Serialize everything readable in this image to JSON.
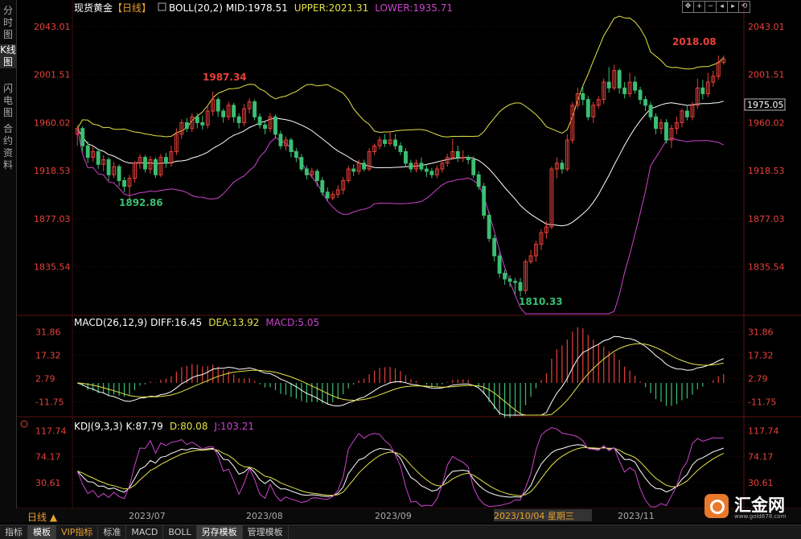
{
  "left_tabs": [
    {
      "label": "分时图",
      "active": false
    },
    {
      "label": "K线图",
      "active": true
    },
    {
      "label": "闪电图",
      "active": false
    },
    {
      "label": "合约资料",
      "active": false
    }
  ],
  "main_header": {
    "title": "现货黄金",
    "period": "【日线】",
    "indicator": "BOLL(20,2)",
    "mid": "MID:1978.51",
    "upper": "UPPER:2021.31",
    "lower": "LOWER:1935.71"
  },
  "macd_header": {
    "title": "MACD(26,12,9)",
    "diff": "DIFF:16.45",
    "dea": "DEA:13.92",
    "macd": "MACD:5.05"
  },
  "kdj_header": {
    "title": "KDJ(9,3,3)",
    "k": "K:87.79",
    "d": "D:80.08",
    "j": "J:103.21"
  },
  "price_axis": {
    "ticks": [
      "2043.01",
      "2001.51",
      "1960.02",
      "1918.53",
      "1877.03",
      "1835.54"
    ],
    "current": "1975.05"
  },
  "macd_axis": {
    "ticks": [
      "31.86",
      "17.32",
      "2.79",
      "-11.75"
    ]
  },
  "kdj_axis": {
    "ticks": [
      "117.74",
      "74.17",
      "30.61"
    ]
  },
  "annotations": {
    "high1": "1987.34",
    "low1": "1892.86",
    "low2": "1810.33",
    "high2": "2018.08"
  },
  "x_axis": {
    "period_label": "日线",
    "labels": [
      "2023/07",
      "2023/08",
      "2023/09",
      "2023/10/04 星期三",
      "2023/11"
    ]
  },
  "toolbar_icons": [
    "cross-arrows",
    "zoom-in",
    "zoom-out",
    "prev",
    "next",
    "restore"
  ],
  "bottom_tabs": [
    {
      "label": "指标",
      "active": false
    },
    {
      "label": "模板",
      "active": true
    },
    {
      "label": "VIP指标",
      "active": false,
      "vip": true
    },
    {
      "label": "标准",
      "active": false
    },
    {
      "label": "MACD",
      "active": false
    },
    {
      "label": "BOLL",
      "active": false
    },
    {
      "label": "另存模板",
      "active": true
    },
    {
      "label": "管理模板",
      "active": false
    }
  ],
  "logo": {
    "text": "汇金网",
    "url": "www.gold678.com"
  },
  "colors": {
    "up": "#e8413a",
    "down": "#3bbf73",
    "mid": "#ffffff",
    "upper": "#e3e34a",
    "lower": "#cc44cc",
    "axis": "#e8413a",
    "grid": "#3a1010"
  },
  "chart_data": {
    "type": "candlestick",
    "title": "现货黄金【日线】",
    "ylim": [
      1795,
      2052
    ],
    "candles": [
      [
        1950,
        1955,
        1958,
        1940
      ],
      [
        1955,
        1940,
        1957,
        1935
      ],
      [
        1940,
        1930,
        1944,
        1925
      ],
      [
        1930,
        1935,
        1940,
        1926
      ],
      [
        1935,
        1924,
        1937,
        1920
      ],
      [
        1924,
        1928,
        1932,
        1918
      ],
      [
        1928,
        1915,
        1930,
        1910
      ],
      [
        1915,
        1922,
        1926,
        1912
      ],
      [
        1922,
        1910,
        1924,
        1905
      ],
      [
        1910,
        1905,
        1913,
        1900
      ],
      [
        1905,
        1912,
        1915,
        1893
      ],
      [
        1912,
        1925,
        1927,
        1908
      ],
      [
        1925,
        1930,
        1933,
        1920
      ],
      [
        1930,
        1920,
        1932,
        1917
      ],
      [
        1920,
        1928,
        1931,
        1916
      ],
      [
        1928,
        1915,
        1930,
        1912
      ],
      [
        1915,
        1930,
        1933,
        1913
      ],
      [
        1930,
        1925,
        1934,
        1921
      ],
      [
        1925,
        1935,
        1940,
        1922
      ],
      [
        1935,
        1950,
        1955,
        1932
      ],
      [
        1950,
        1960,
        1963,
        1946
      ],
      [
        1960,
        1955,
        1964,
        1952
      ],
      [
        1955,
        1965,
        1968,
        1952
      ],
      [
        1965,
        1960,
        1968,
        1955
      ],
      [
        1960,
        1958,
        1966,
        1954
      ],
      [
        1958,
        1970,
        1975,
        1955
      ],
      [
        1970,
        1980,
        1987,
        1966
      ],
      [
        1980,
        1970,
        1982,
        1965
      ],
      [
        1970,
        1965,
        1972,
        1960
      ],
      [
        1965,
        1975,
        1978,
        1962
      ],
      [
        1975,
        1965,
        1977,
        1960
      ],
      [
        1965,
        1960,
        1968,
        1955
      ],
      [
        1960,
        1972,
        1976,
        1957
      ],
      [
        1972,
        1978,
        1981,
        1968
      ],
      [
        1978,
        1965,
        1980,
        1962
      ],
      [
        1965,
        1958,
        1968,
        1955
      ],
      [
        1958,
        1955,
        1961,
        1950
      ],
      [
        1955,
        1965,
        1968,
        1952
      ],
      [
        1965,
        1950,
        1967,
        1947
      ],
      [
        1950,
        1940,
        1953,
        1937
      ],
      [
        1940,
        1945,
        1948,
        1936
      ],
      [
        1945,
        1935,
        1947,
        1930
      ],
      [
        1935,
        1930,
        1938,
        1926
      ],
      [
        1930,
        1920,
        1933,
        1918
      ],
      [
        1920,
        1915,
        1923,
        1911
      ],
      [
        1915,
        1918,
        1921,
        1912
      ],
      [
        1918,
        1910,
        1920,
        1905
      ],
      [
        1910,
        1900,
        1913,
        1897
      ],
      [
        1900,
        1895,
        1904,
        1892
      ],
      [
        1895,
        1898,
        1901,
        1893
      ],
      [
        1898,
        1902,
        1906,
        1895
      ],
      [
        1902,
        1910,
        1913,
        1898
      ],
      [
        1910,
        1920,
        1923,
        1908
      ],
      [
        1920,
        1918,
        1924,
        1914
      ],
      [
        1918,
        1925,
        1928,
        1915
      ],
      [
        1925,
        1920,
        1928,
        1918
      ],
      [
        1920,
        1935,
        1938,
        1918
      ],
      [
        1935,
        1940,
        1942,
        1932
      ],
      [
        1940,
        1945,
        1948,
        1937
      ],
      [
        1945,
        1942,
        1950,
        1939
      ],
      [
        1942,
        1945,
        1952,
        1940
      ],
      [
        1945,
        1940,
        1950,
        1937
      ],
      [
        1940,
        1935,
        1943,
        1932
      ],
      [
        1935,
        1925,
        1938,
        1922
      ],
      [
        1925,
        1920,
        1928,
        1917
      ],
      [
        1920,
        1925,
        1928,
        1917
      ],
      [
        1925,
        1920,
        1930,
        1918
      ],
      [
        1920,
        1918,
        1923,
        1913
      ],
      [
        1918,
        1915,
        1921,
        1912
      ],
      [
        1915,
        1920,
        1923,
        1912
      ],
      [
        1920,
        1925,
        1928,
        1917
      ],
      [
        1925,
        1930,
        1933,
        1922
      ],
      [
        1930,
        1935,
        1946,
        1928
      ],
      [
        1935,
        1930,
        1940,
        1926
      ],
      [
        1930,
        1930,
        1936,
        1926
      ],
      [
        1930,
        1928,
        1932,
        1924
      ],
      [
        1928,
        1915,
        1931,
        1912
      ],
      [
        1915,
        1905,
        1918,
        1902
      ],
      [
        1905,
        1880,
        1908,
        1877
      ],
      [
        1880,
        1860,
        1883,
        1857
      ],
      [
        1860,
        1845,
        1863,
        1840
      ],
      [
        1845,
        1830,
        1848,
        1826
      ],
      [
        1830,
        1825,
        1833,
        1820
      ],
      [
        1825,
        1823,
        1828,
        1818
      ],
      [
        1823,
        1822,
        1826,
        1812
      ],
      [
        1822,
        1815,
        1826,
        1810
      ],
      [
        1815,
        1840,
        1842,
        1812
      ],
      [
        1840,
        1845,
        1850,
        1838
      ],
      [
        1845,
        1855,
        1858,
        1840
      ],
      [
        1855,
        1865,
        1868,
        1850
      ],
      [
        1865,
        1870,
        1875,
        1860
      ],
      [
        1870,
        1920,
        1922,
        1868
      ],
      [
        1920,
        1925,
        1930,
        1912
      ],
      [
        1925,
        1920,
        1928,
        1916
      ],
      [
        1920,
        1945,
        1950,
        1918
      ],
      [
        1945,
        1975,
        1978,
        1942
      ],
      [
        1975,
        1985,
        1990,
        1972
      ],
      [
        1985,
        1980,
        1992,
        1975
      ],
      [
        1980,
        1965,
        1983,
        1962
      ],
      [
        1965,
        1975,
        1978,
        1960
      ],
      [
        1975,
        1980,
        1983,
        1972
      ],
      [
        1980,
        1995,
        1998,
        1976
      ],
      [
        1995,
        1990,
        2008,
        1986
      ],
      [
        1990,
        2005,
        2010,
        1988
      ],
      [
        2005,
        1990,
        2007,
        1985
      ],
      [
        1990,
        1985,
        1995,
        1981
      ],
      [
        1985,
        1995,
        2003,
        1982
      ],
      [
        1995,
        1988,
        2000,
        1985
      ],
      [
        1988,
        1980,
        1991,
        1976
      ],
      [
        1980,
        1975,
        1983,
        1970
      ],
      [
        1975,
        1965,
        1978,
        1962
      ],
      [
        1965,
        1955,
        1968,
        1950
      ],
      [
        1955,
        1960,
        1963,
        1950
      ],
      [
        1960,
        1945,
        1963,
        1942
      ],
      [
        1945,
        1955,
        1958,
        1938
      ],
      [
        1955,
        1960,
        1965,
        1950
      ],
      [
        1960,
        1970,
        1972,
        1956
      ],
      [
        1970,
        1965,
        1975,
        1962
      ],
      [
        1965,
        1975,
        1978,
        1962
      ],
      [
        1975,
        1990,
        1998,
        1972
      ],
      [
        1990,
        1985,
        1997,
        1980
      ],
      [
        1985,
        1995,
        2003,
        1982
      ],
      [
        1995,
        2000,
        2005,
        1991
      ],
      [
        2000,
        2012,
        2018,
        1997
      ],
      [
        2012,
        2015,
        2018,
        2010
      ]
    ]
  }
}
